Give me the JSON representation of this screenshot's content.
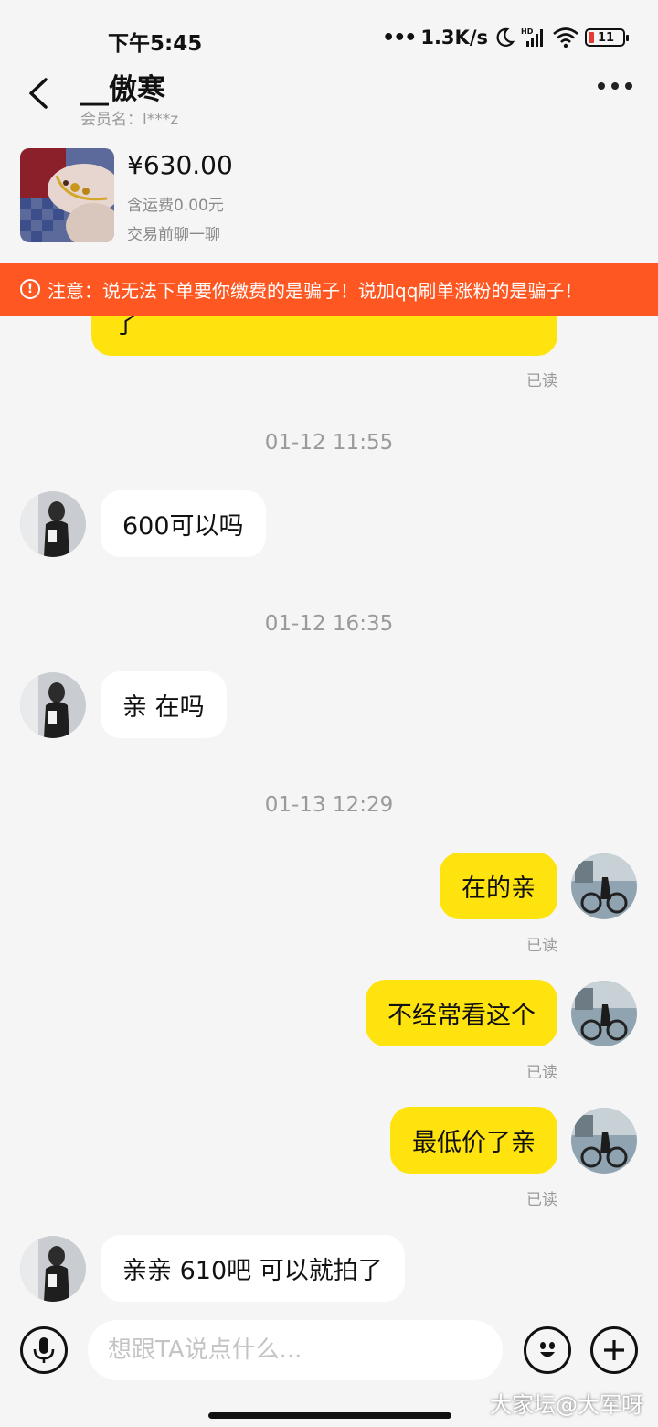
{
  "status_bar": {
    "time": "下午5:45",
    "dots": "•••",
    "net_speed": "1.3K/s",
    "battery_level": "11"
  },
  "header": {
    "title": "__傲寒",
    "member_label": "会员名：l***z"
  },
  "product": {
    "price": "¥630.00",
    "shipping": "含运费0.00元",
    "hint": "交易前聊一聊"
  },
  "warning": {
    "text": "注意：说无法下单要你缴费的是骗子！说加qq刷单涨粉的是骗子！",
    "color": "#ff5722"
  },
  "messages": [
    {
      "type": "outgoing",
      "text": "了",
      "read": "已读"
    },
    {
      "type": "timestamp",
      "text": "01-12 11:55"
    },
    {
      "type": "incoming",
      "text": "600可以吗"
    },
    {
      "type": "timestamp",
      "text": "01-12 16:35"
    },
    {
      "type": "incoming",
      "text": "亲 在吗"
    },
    {
      "type": "timestamp",
      "text": "01-13 12:29"
    },
    {
      "type": "outgoing",
      "text": "在的亲",
      "read": "已读"
    },
    {
      "type": "outgoing",
      "text": "不经常看这个",
      "read": "已读"
    },
    {
      "type": "outgoing",
      "text": "最低价了亲",
      "read": "已读"
    },
    {
      "type": "incoming",
      "text": "亲亲 610吧 可以就拍了"
    }
  ],
  "input": {
    "placeholder": "想跟TA说点什么..."
  },
  "icons": {
    "voice": "microphone-icon",
    "emoji": "emoji-icon",
    "plus": "plus-icon"
  },
  "colors": {
    "outgoing_bubble": "#ffe30f",
    "incoming_bubble": "#ffffff",
    "background": "#f5f5f5"
  },
  "watermark": "大家坛@大军呀"
}
